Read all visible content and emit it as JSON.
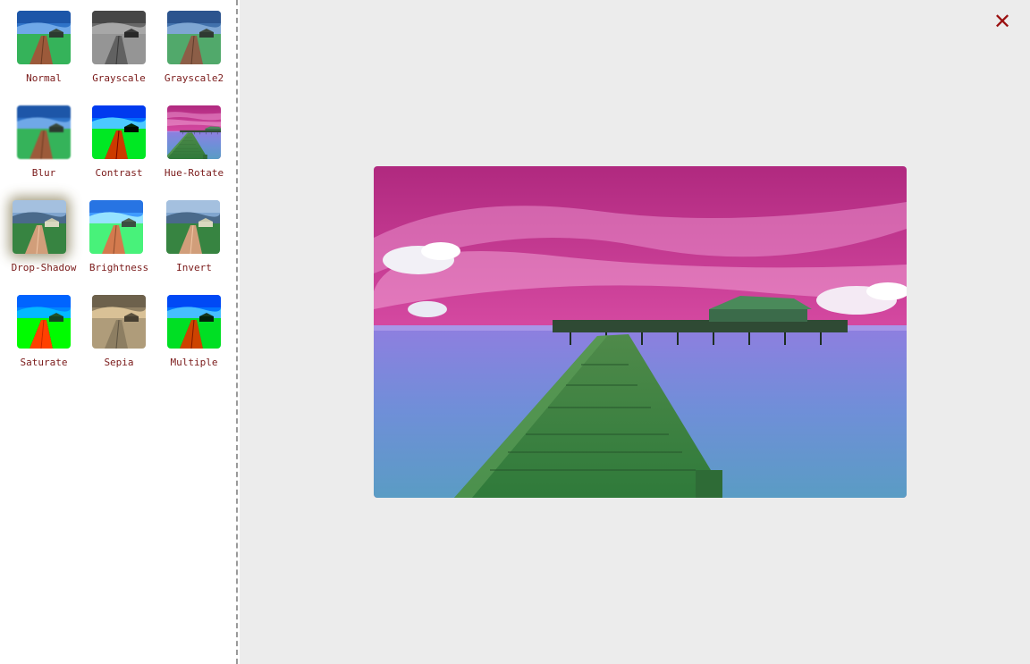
{
  "filters": [
    {
      "label": "Normal",
      "icon": "scene-normal-thumbnail",
      "css_filter": "none"
    },
    {
      "label": "Grayscale",
      "icon": "scene-grayscale-thumbnail",
      "css_filter": "grayscale(100%)"
    },
    {
      "label": "Grayscale2",
      "icon": "scene-grayscale2-thumbnail",
      "css_filter": "grayscale(30%)"
    },
    {
      "label": "Blur",
      "icon": "scene-blur-thumbnail",
      "css_filter": "blur(1px)"
    },
    {
      "label": "Contrast",
      "icon": "scene-contrast-thumbnail",
      "css_filter": "contrast(180%)"
    },
    {
      "label": "Hue-Rotate",
      "icon": "scene-hue-rotate-thumbnail",
      "css_filter": "hue-rotate(90deg)"
    },
    {
      "label": "Drop-Shadow",
      "icon": "scene-drop-shadow-thumbnail",
      "css_filter": "invert(100%)"
    },
    {
      "label": "Brightness",
      "icon": "scene-brightness-thumbnail",
      "css_filter": "brightness(130%)"
    },
    {
      "label": "Invert",
      "icon": "scene-invert-thumbnail",
      "css_filter": "invert(100%)"
    },
    {
      "label": "Saturate",
      "icon": "scene-saturate-thumbnail",
      "css_filter": "saturate(300%)"
    },
    {
      "label": "Sepia",
      "icon": "scene-sepia-thumbnail",
      "css_filter": "sepia(100%)"
    },
    {
      "label": "Multiple",
      "icon": "scene-multiple-thumbnail",
      "css_filter": "contrast(140%) saturate(140%)"
    }
  ],
  "viewer": {
    "close_label": "✕",
    "close_icon": "close-icon",
    "preview_icon": "scene-hue-rotate-preview-image",
    "active_filter": "Hue-Rotate"
  },
  "colors": {
    "label_text": "#7a1a1a",
    "close_button": "#9b1010",
    "viewer_background": "#ececec",
    "divider": "#9a9a9a"
  }
}
